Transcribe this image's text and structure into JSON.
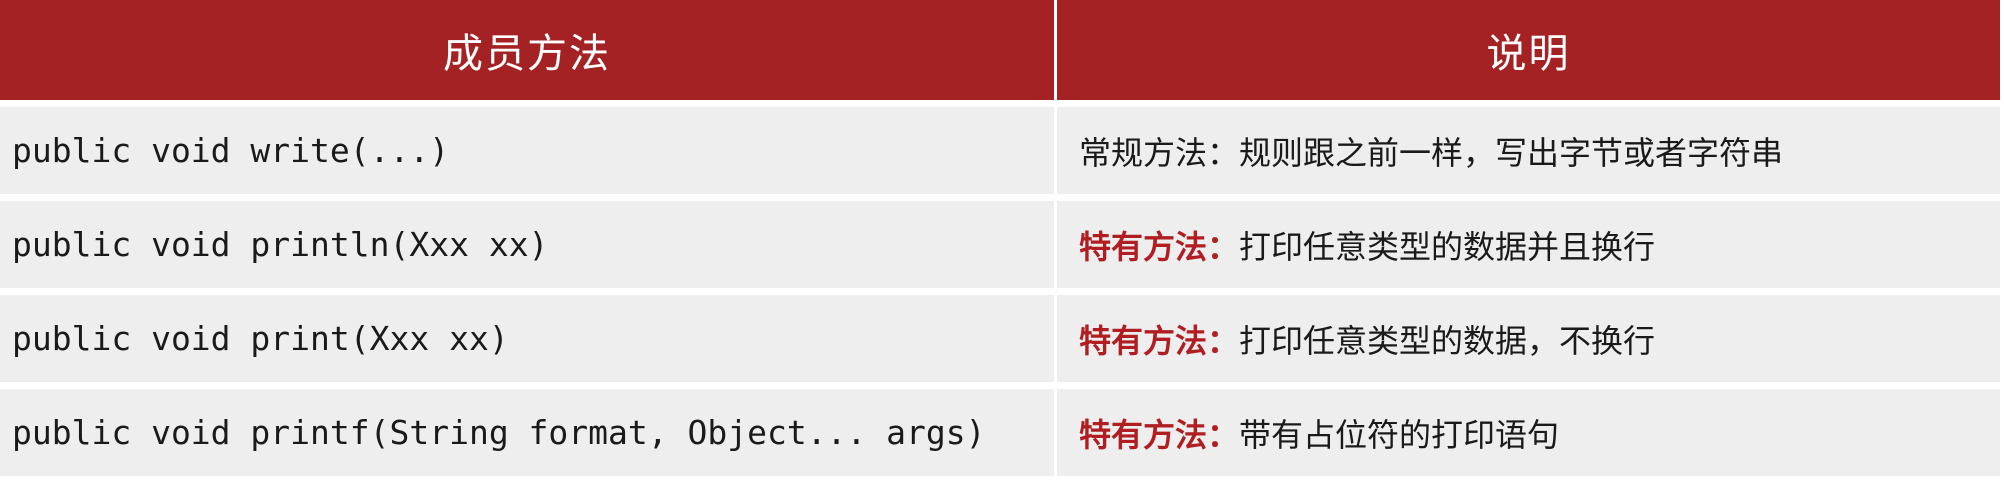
{
  "table": {
    "headers": {
      "method": "成员方法",
      "description": "说明"
    },
    "rows": [
      {
        "method": "public void write(...)",
        "tag": "",
        "desc": "常规方法：规则跟之前一样，写出字节或者字符串"
      },
      {
        "method": "public void println(Xxx xx)",
        "tag": "特有方法：",
        "desc": "打印任意类型的数据并且换行"
      },
      {
        "method": "public void print(Xxx xx)",
        "tag": "特有方法：",
        "desc": "打印任意类型的数据，不换行"
      },
      {
        "method": "public void printf(String format, Object... args)",
        "tag": "特有方法：",
        "desc": "带有占位符的打印语句"
      }
    ]
  },
  "colors": {
    "header_bg": "#a52224",
    "highlight": "#b01e22",
    "row_bg": "#eeeeee"
  }
}
